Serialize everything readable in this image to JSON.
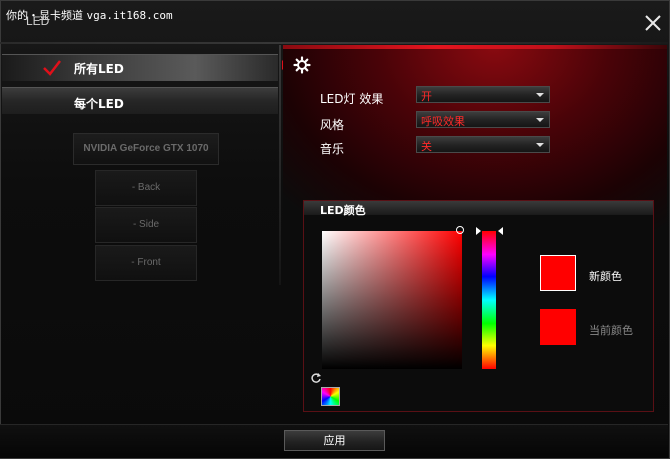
{
  "watermark": {
    "prefix": "你的・显卡频道",
    "url": "vga.it168.com"
  },
  "window": {
    "title": "LED"
  },
  "nav": {
    "items": [
      {
        "label": "所有LED",
        "active": true
      },
      {
        "label": "每个LED",
        "active": false
      }
    ]
  },
  "devices": {
    "gpu": "NVIDIA GeForce GTX 1070",
    "zones": [
      "- Back",
      "- Side",
      "- Front"
    ]
  },
  "settings": {
    "effect_label": "LED灯 效果",
    "effect_value": "开",
    "style_label": "风格",
    "style_value": "呼吸效果",
    "music_label": "音乐",
    "music_value": "关"
  },
  "color": {
    "section_title": "LED颜色",
    "new_label": "新颜色",
    "current_label": "当前颜色",
    "new_color": "#ff0000",
    "current_color": "#ff0000",
    "hue": 0
  },
  "footer": {
    "apply_label": "应用"
  },
  "icons": {
    "check": "check-icon",
    "gear": "gear-icon",
    "close": "close-icon",
    "reset": "reset-icon",
    "spectrum": "spectrum-icon"
  },
  "theme": {
    "accent": "#e0101a"
  }
}
